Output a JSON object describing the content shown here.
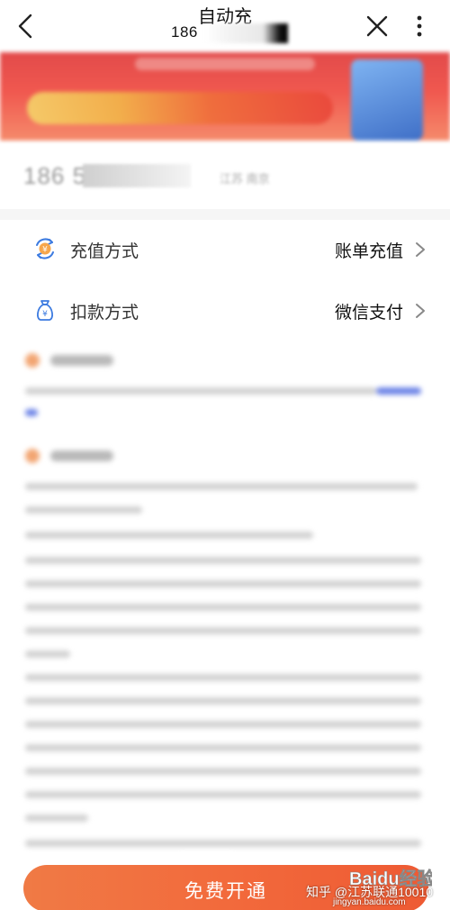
{
  "header": {
    "title": "自动充",
    "subtitle": "186"
  },
  "account": {
    "phone_prefix": "186 5",
    "region": "江苏 南京"
  },
  "menu": [
    {
      "label": "充值方式",
      "value": "账单充值",
      "icon": "yuan-refresh-icon"
    },
    {
      "label": "扣款方式",
      "value": "微信支付",
      "icon": "money-bag-icon"
    }
  ],
  "cta": {
    "label": "免费开通"
  },
  "watermarks": {
    "zhihu": "知乎 @江苏联通10010",
    "jingyan": "jingyan.baidu.com",
    "baidu": "Baidu经验"
  },
  "colors": {
    "accent": "#f26a3c",
    "icon_blue": "#3d7be0",
    "banner_red": "#e24a4a"
  }
}
